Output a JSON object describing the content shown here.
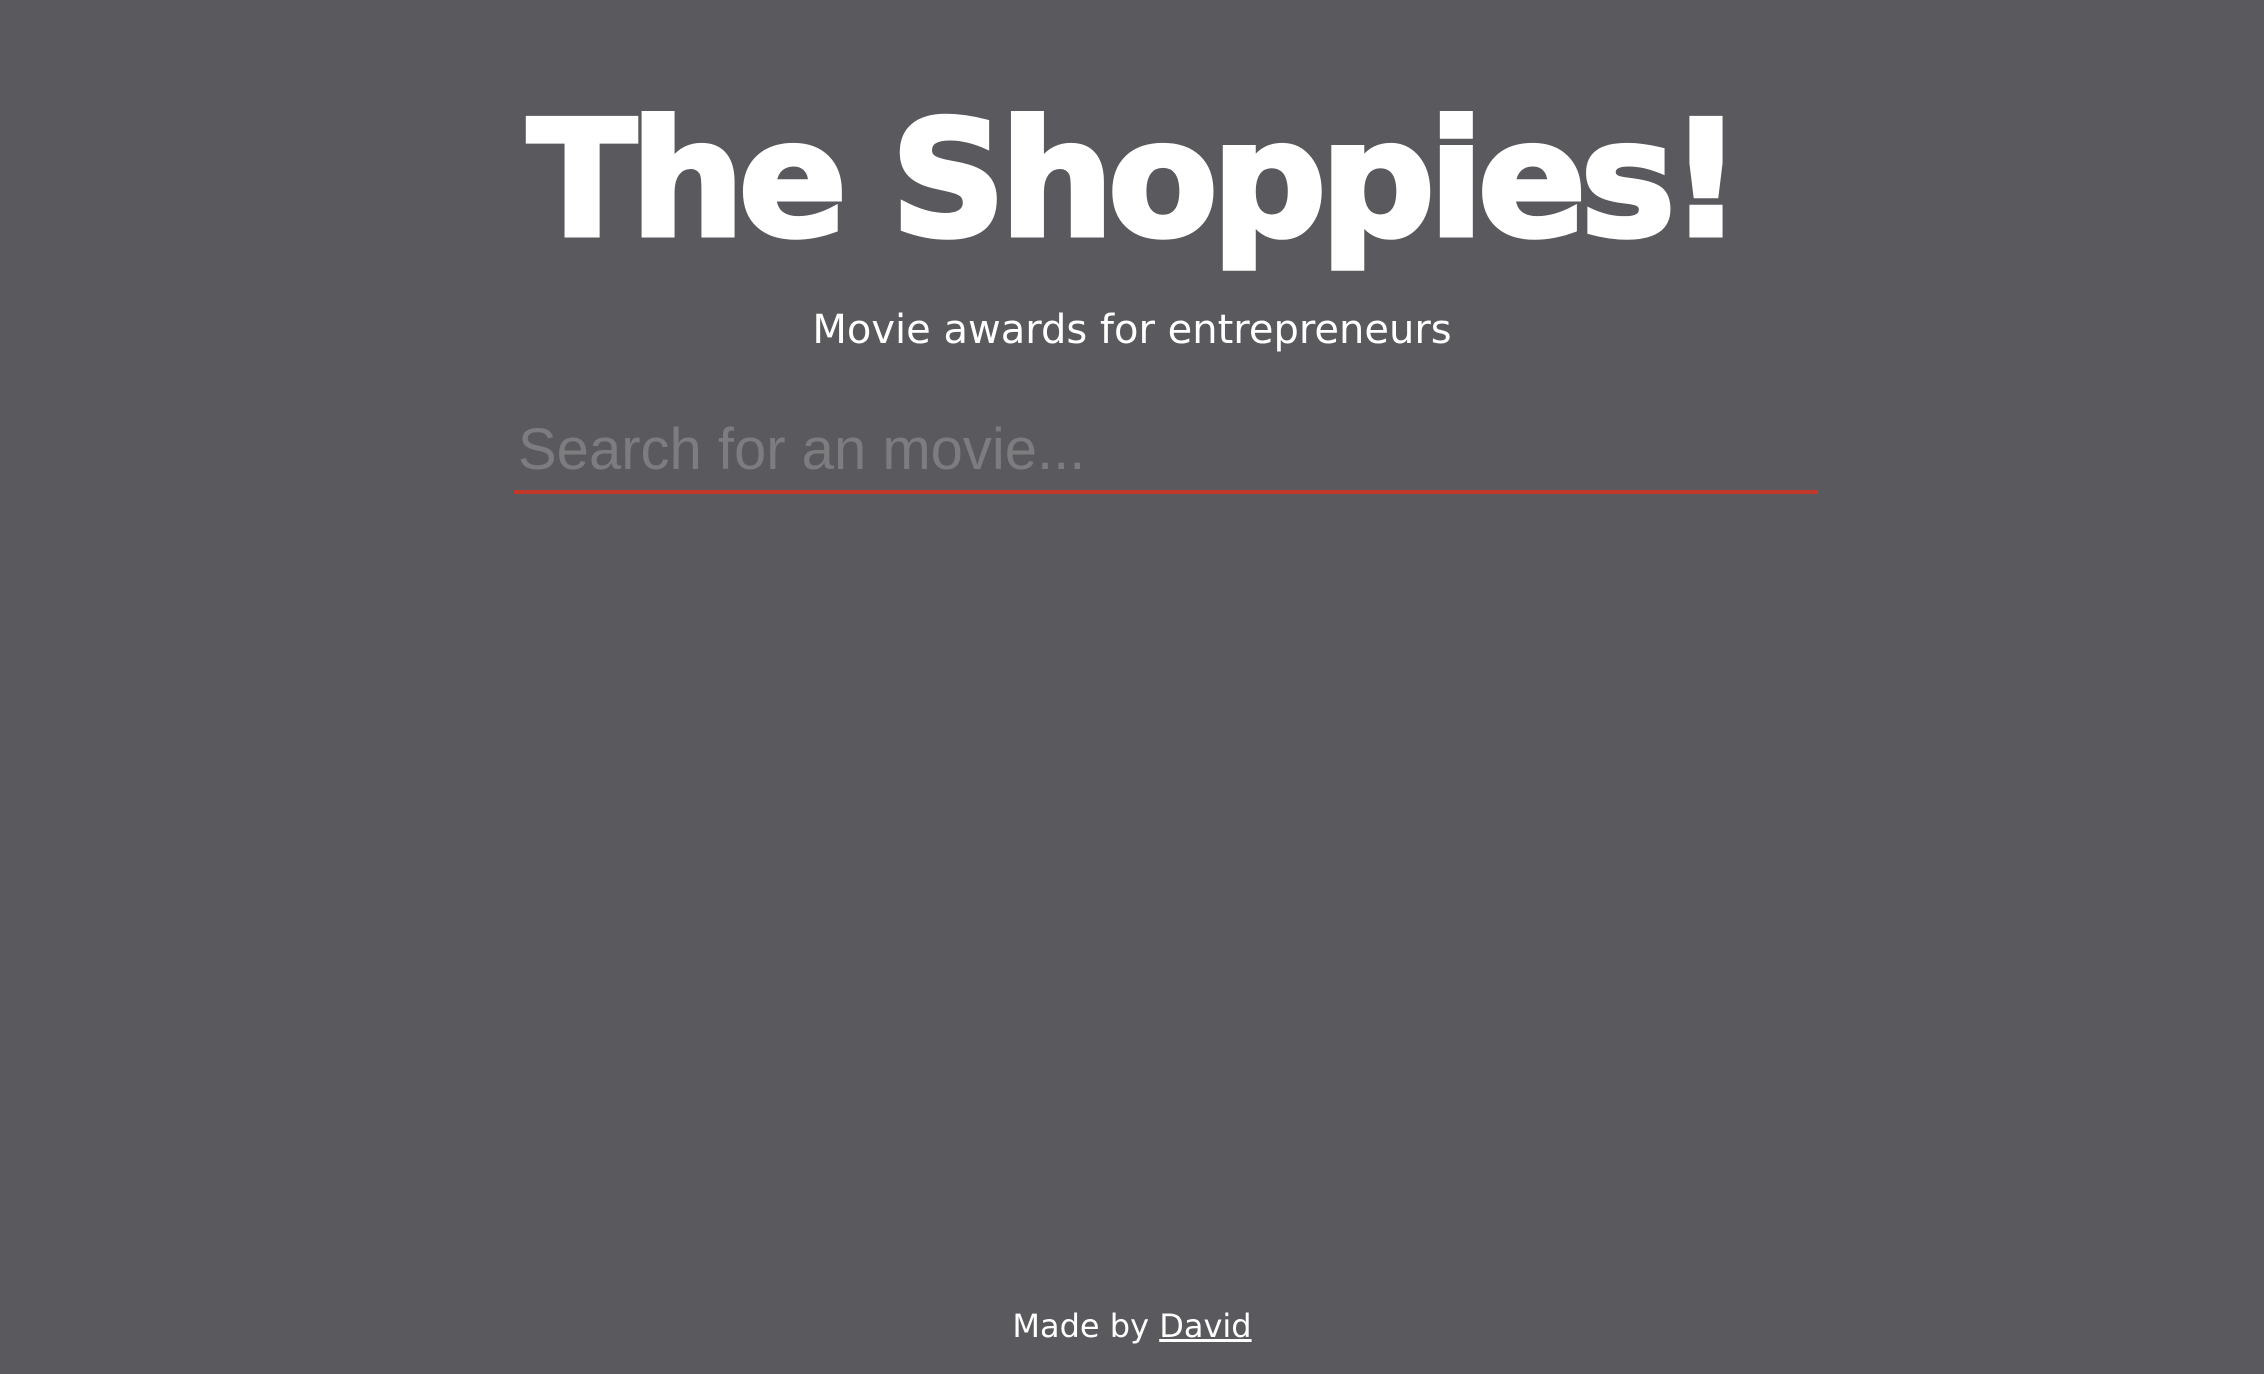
{
  "header": {
    "title": "The Shoppies!",
    "subtitle": "Movie awards for entrepreneurs"
  },
  "search": {
    "value": "",
    "placeholder": "Search for an movie..."
  },
  "footer": {
    "made_by_text": "Made by",
    "author_link": "David"
  },
  "colors": {
    "background": "#5a595e",
    "text": "#ffffff",
    "accent_underline": "#c0392b",
    "placeholder": "#7d7d80"
  }
}
